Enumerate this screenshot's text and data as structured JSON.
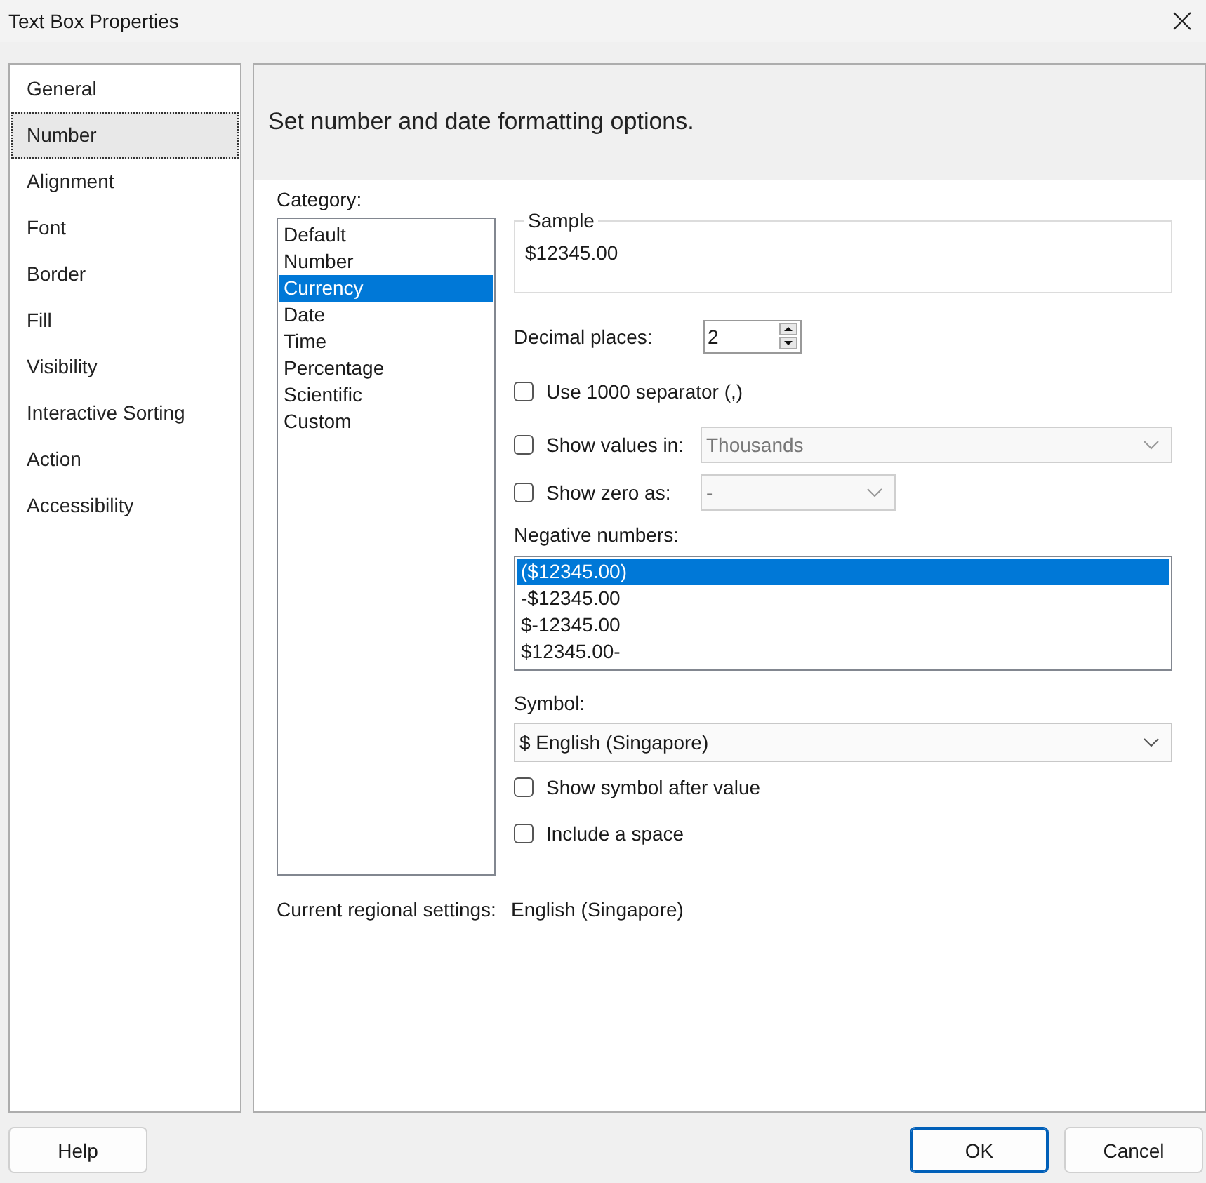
{
  "window": {
    "title": "Text Box Properties"
  },
  "sidebar": {
    "items": [
      {
        "label": "General",
        "selected": false
      },
      {
        "label": "Number",
        "selected": true
      },
      {
        "label": "Alignment",
        "selected": false
      },
      {
        "label": "Font",
        "selected": false
      },
      {
        "label": "Border",
        "selected": false
      },
      {
        "label": "Fill",
        "selected": false
      },
      {
        "label": "Visibility",
        "selected": false
      },
      {
        "label": "Interactive Sorting",
        "selected": false
      },
      {
        "label": "Action",
        "selected": false
      },
      {
        "label": "Accessibility",
        "selected": false
      }
    ]
  },
  "header": {
    "text": "Set number and date formatting options."
  },
  "category": {
    "label": "Category:",
    "items": [
      {
        "label": "Default",
        "selected": false
      },
      {
        "label": "Number",
        "selected": false
      },
      {
        "label": "Currency",
        "selected": true
      },
      {
        "label": "Date",
        "selected": false
      },
      {
        "label": "Time",
        "selected": false
      },
      {
        "label": "Percentage",
        "selected": false
      },
      {
        "label": "Scientific",
        "selected": false
      },
      {
        "label": "Custom",
        "selected": false
      }
    ]
  },
  "sample": {
    "legend": "Sample",
    "value": "$12345.00"
  },
  "decimal_places": {
    "label": "Decimal places:",
    "value": "2"
  },
  "options": [
    {
      "kind": "checkbox",
      "label": "Use 1000 separator (,)",
      "checked": false
    },
    {
      "kind": "combo",
      "label": "Show values in:",
      "checked": false,
      "combo": {
        "value": "Thousands",
        "disabled": true
      }
    },
    {
      "kind": "combo",
      "label": "Show zero as:",
      "checked": false,
      "combo": {
        "value": "-",
        "disabled": true
      }
    }
  ],
  "negative_numbers": {
    "label": "Negative numbers:",
    "items": [
      {
        "label": "($12345.00)",
        "selected": true
      },
      {
        "label": "-$12345.00",
        "selected": false
      },
      {
        "label": "$-12345.00",
        "selected": false
      },
      {
        "label": "$12345.00-",
        "selected": false
      }
    ]
  },
  "symbol": {
    "label": "Symbol:",
    "value": "$ English (Singapore)"
  },
  "symbol_options": [
    {
      "label": "Show symbol after value",
      "checked": false
    },
    {
      "label": "Include a space",
      "checked": false
    }
  ],
  "regional": {
    "label": "Current regional settings:",
    "value": "English (Singapore)"
  },
  "buttons": [
    {
      "label": "Help",
      "kind": "left",
      "default": false
    },
    {
      "label": "OK",
      "kind": "right",
      "default": true
    },
    {
      "label": "Cancel",
      "kind": "right",
      "default": false
    }
  ]
}
